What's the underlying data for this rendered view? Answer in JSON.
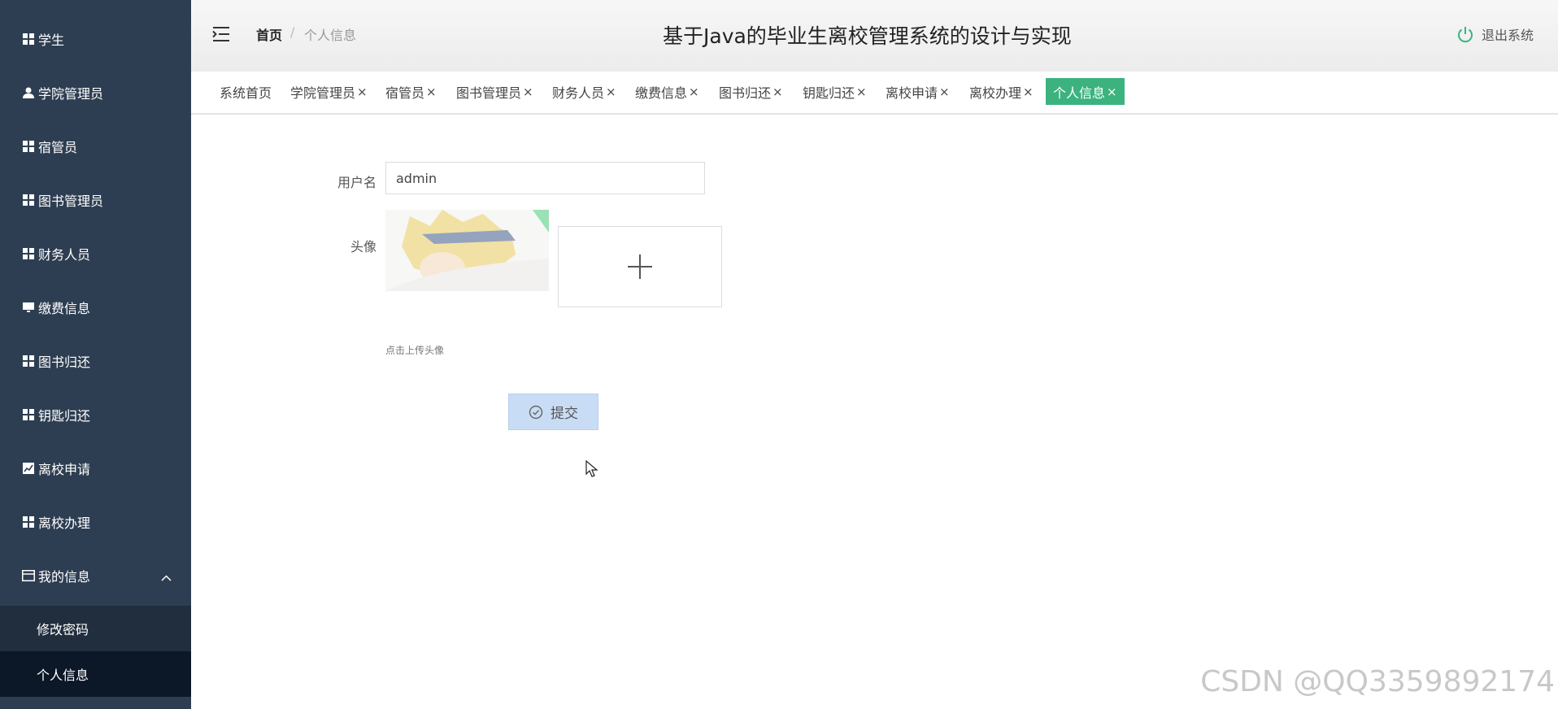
{
  "sidebar": {
    "items": [
      {
        "label": "学生",
        "icon": "grid-icon"
      },
      {
        "label": "学院管理员",
        "icon": "user-icon"
      },
      {
        "label": "宿管员",
        "icon": "grid-icon"
      },
      {
        "label": "图书管理员",
        "icon": "grid-icon"
      },
      {
        "label": "财务人员",
        "icon": "grid-icon"
      },
      {
        "label": "缴费信息",
        "icon": "monitor-icon"
      },
      {
        "label": "图书归还",
        "icon": "grid-icon"
      },
      {
        "label": "钥匙归还",
        "icon": "grid-icon"
      },
      {
        "label": "离校申请",
        "icon": "chart-icon"
      },
      {
        "label": "离校办理",
        "icon": "grid-icon"
      },
      {
        "label": "我的信息",
        "icon": "card-icon"
      }
    ],
    "submenu": [
      {
        "label": "修改密码"
      },
      {
        "label": "个人信息"
      }
    ]
  },
  "header": {
    "breadcrumb_home": "首页",
    "breadcrumb_separator": "/",
    "breadcrumb_current": "个人信息",
    "title": "基于Java的毕业生离校管理系统的设计与实现",
    "logout_label": "退出系统"
  },
  "tabs": [
    {
      "label": "系统首页"
    },
    {
      "label": "学院管理员",
      "close": "×"
    },
    {
      "label": "宿管员",
      "close": "×"
    },
    {
      "label": "图书管理员",
      "close": "×"
    },
    {
      "label": "财务人员",
      "close": "×"
    },
    {
      "label": "缴费信息",
      "close": "×"
    },
    {
      "label": "图书归还",
      "close": "×"
    },
    {
      "label": "钥匙归还",
      "close": "×"
    },
    {
      "label": "离校申请",
      "close": "×"
    },
    {
      "label": "离校办理",
      "close": "×"
    },
    {
      "label": "个人信息",
      "close": "×"
    }
  ],
  "form": {
    "username_label": "用户名",
    "username_value": "admin",
    "avatar_label": "头像",
    "upload_hint": "点击上传头像",
    "submit_label": "提交"
  },
  "watermark": "CSDN @QQ3359892174",
  "colors": {
    "sidebar_bg": "#2e3e52",
    "accent": "#3cb37f",
    "submit_bg": "#c9dcf5"
  }
}
